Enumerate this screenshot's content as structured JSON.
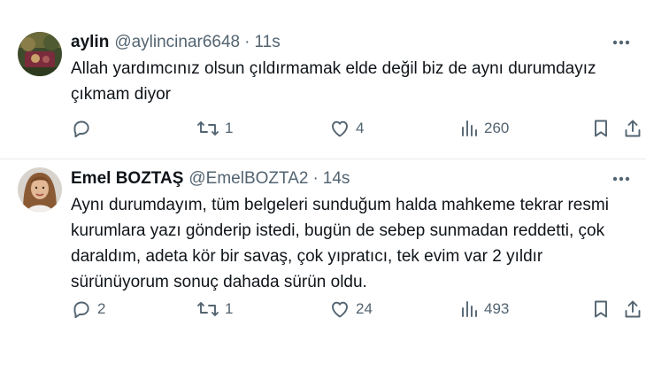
{
  "tweets": [
    {
      "display_name": "aylin",
      "handle": "@aylincinar6648",
      "separator": "·",
      "time": "11s",
      "text_lines": [
        "Allah yardımcınız olsun çıldırmamak elde değil biz de aynı durumdayız",
        "çıkmam diyor"
      ],
      "replies": "",
      "retweets": "1",
      "likes": "4",
      "views": "260"
    },
    {
      "display_name": "Emel BOZTAŞ",
      "handle": "@EmelBOZTA2",
      "separator": "·",
      "time": "14s",
      "text_lines": [
        "Aynı durumdayım, tüm belgeleri sunduğum halda mahkeme tekrar resmi",
        "kurumlara yazı gönderip istedi, bugün de sebep sunmadan reddetti, çok",
        "daraldım, adeta kör bir savaş, çok yıpratıcı, tek evim var 2 yıldır",
        "sürünüyorum sonuç dahada sürün oldu."
      ],
      "replies": "2",
      "retweets": "1",
      "likes": "24",
      "views": "493"
    }
  ],
  "icons": {
    "more": "more-icon",
    "reply": "reply-icon",
    "retweet": "retweet-icon",
    "like": "heart-icon",
    "views": "views-icon",
    "bookmark": "bookmark-icon",
    "share": "share-icon"
  },
  "colors": {
    "text": "#0f1419",
    "secondary": "#536471",
    "divider": "#e6e9ec"
  }
}
